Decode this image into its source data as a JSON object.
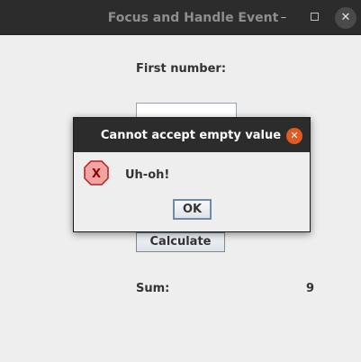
{
  "window": {
    "title": "Focus and Handle Event",
    "minimize_glyph": "–",
    "close_glyph": "✕"
  },
  "form": {
    "first_number_label": "First number:",
    "first_number_value": "",
    "calculate_label": "Calculate",
    "sum_label": "Sum:",
    "sum_value": "9"
  },
  "dialog": {
    "title": "Cannot accept empty value",
    "message": "Uh-oh!",
    "ok_label": "OK",
    "close_glyph": "✕",
    "icon": "error-icon",
    "icon_letter": "X"
  },
  "colors": {
    "titlebar": "#2c2c2c",
    "dialog_close": "#e05a23",
    "error_icon_fill": "#f4a3a3",
    "error_icon_stroke": "#b22222"
  }
}
